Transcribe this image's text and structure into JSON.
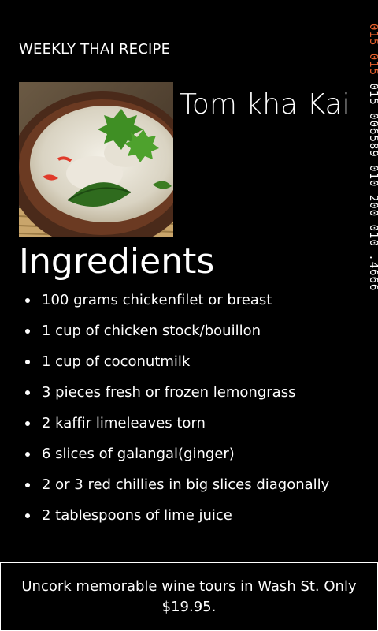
{
  "header": {
    "app_title": "WEEKLY THAI RECIPE"
  },
  "recipe": {
    "title": "Tom kha Kai",
    "photo_icon": "recipe-photo-soup"
  },
  "ingredients": {
    "heading": "Ingredients",
    "items": [
      "100 grams chickenfilet or breast",
      "1 cup of chicken stock/bouillon",
      "1 cup of coconutmilk",
      "3 pieces fresh or frozen lemongrass",
      "2 kaffir limeleaves torn",
      "6 slices of galangal(ginger)",
      "2 or 3 red chillies in big slices diagonally",
      "2 tablespoons of lime juice"
    ]
  },
  "debug_overlay": {
    "accent_segment": "015 015",
    "main_segment": " 015 006589 010 200 010 .4666",
    "accent_color": "#e8602c"
  },
  "ad": {
    "text": "Uncork memorable wine tours in Wash St. Only $19.95."
  }
}
